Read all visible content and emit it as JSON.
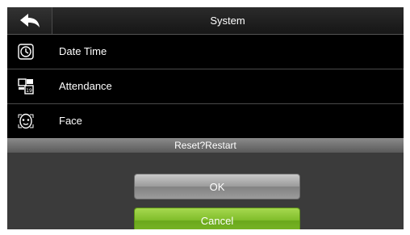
{
  "header": {
    "title": "System",
    "back_icon": "back-arrow-icon"
  },
  "menu": {
    "items": [
      {
        "label": "Date Time",
        "icon": "clock-icon"
      },
      {
        "label": "Attendance",
        "icon": "attendance-icon"
      },
      {
        "label": "Face",
        "icon": "face-icon"
      }
    ]
  },
  "dialog": {
    "title": "Reset?Restart",
    "ok_label": "OK",
    "cancel_label": "Cancel"
  },
  "colors": {
    "ok_button": "#9a9a9a",
    "cancel_button": "#7fbd2a",
    "background": "#000000"
  }
}
